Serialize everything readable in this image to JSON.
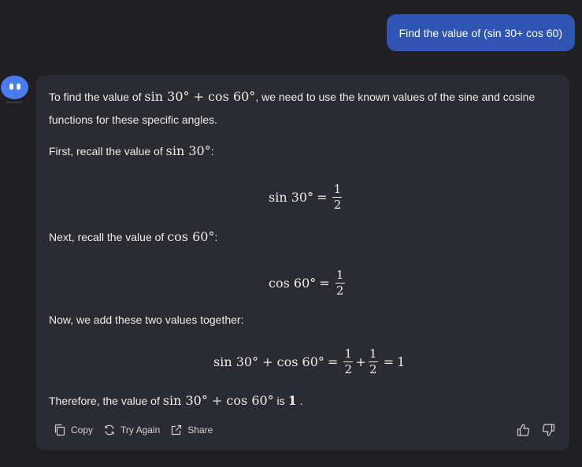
{
  "user_message": "Find the value of (sin 30+ cos 60)",
  "answer": {
    "intro_1": "To find the value of ",
    "intro_math": "sin 30° + cos 60°",
    "intro_2": ", we need to use the known values of the sine and cosine",
    "intro_3": "functions for these specific angles.",
    "step1_text": "First, recall the value of ",
    "step1_math": "sin 30°",
    "step1_suffix": ":",
    "eq1_lhs": "sin 30°",
    "eq1_eq": "=",
    "eq1_num": "1",
    "eq1_den": "2",
    "step2_text": "Next, recall the value of ",
    "step2_math": "cos 60°",
    "step2_suffix": ":",
    "eq2_lhs": "cos 60°",
    "eq2_eq": "=",
    "eq2_num": "1",
    "eq2_den": "2",
    "step3_text": "Now, we add these two values together:",
    "eq3_lhs": "sin 30° + cos 60°",
    "eq3_eq": "=",
    "eq3_num1": "1",
    "eq3_den1": "2",
    "eq3_plus": "+",
    "eq3_num2": "1",
    "eq3_den2": "2",
    "eq3_eq2": "=",
    "eq3_result": "1",
    "concl_text": "Therefore, the value of ",
    "concl_math": "sin 30° + cos 60°",
    "concl_is": " is ",
    "concl_result": "1",
    "concl_period": " ."
  },
  "actions": {
    "copy": "Copy",
    "try_again": "Try Again",
    "share": "Share"
  },
  "colors": {
    "background": "#202024",
    "user_bubble": "#2f55b4",
    "card": "#2b2b32",
    "avatar": "#4a7bf0"
  },
  "icons": [
    "copy-icon",
    "refresh-icon",
    "share-icon",
    "thumbs-up-icon",
    "thumbs-down-icon",
    "bot-avatar"
  ]
}
